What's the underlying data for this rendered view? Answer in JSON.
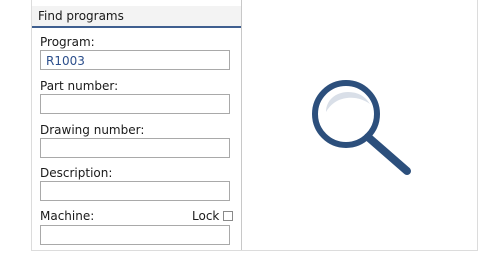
{
  "panel": {
    "title": "Find programs"
  },
  "fields": {
    "program": {
      "label": "Program:",
      "value": "R1003"
    },
    "part_number": {
      "label": "Part number:",
      "value": ""
    },
    "drawing_number": {
      "label": "Drawing number:",
      "value": ""
    },
    "description": {
      "label": "Description:",
      "value": ""
    },
    "machine": {
      "label": "Machine:",
      "value": ""
    }
  },
  "lock": {
    "label": "Lock",
    "checked": false
  },
  "preview": {
    "icon": "search-icon",
    "accent_color": "#2c4f7c"
  }
}
